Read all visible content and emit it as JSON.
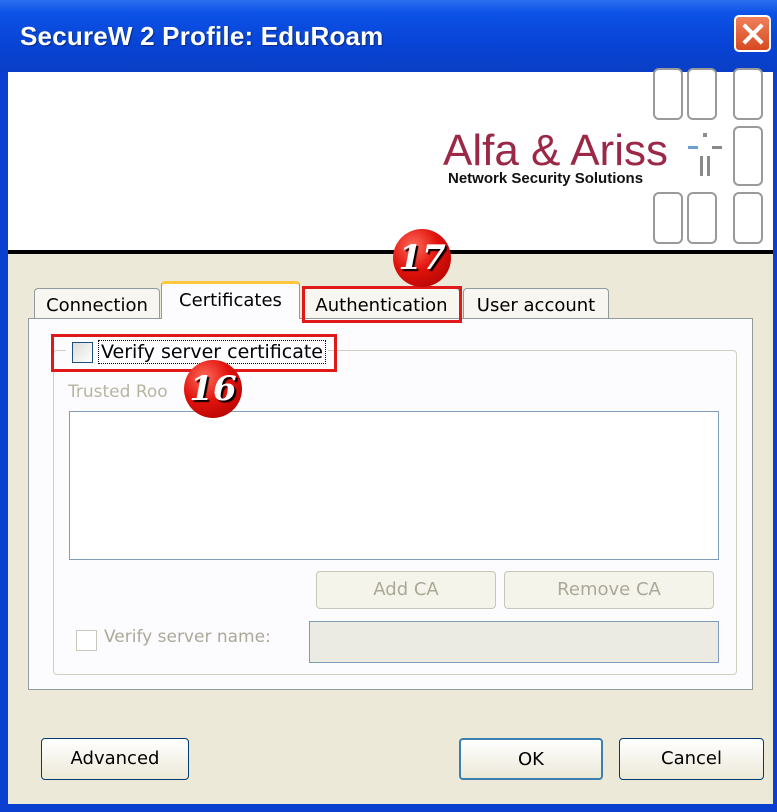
{
  "window": {
    "title": "SecureW 2 Profile: EduRoam"
  },
  "banner": {
    "company": "Alfa & Ariss",
    "tagline": "Network Security Solutions"
  },
  "tabs": [
    {
      "label": "Connection",
      "active": false
    },
    {
      "label": "Certificates",
      "active": true
    },
    {
      "label": "Authentication",
      "active": false
    },
    {
      "label": "User account",
      "active": false
    }
  ],
  "certificates": {
    "verify_server_certificate": {
      "label": "Verify server certificate",
      "checked": false
    },
    "trusted_root_label": "Trusted Roo",
    "add_ca": "Add CA",
    "remove_ca": "Remove CA",
    "verify_server_name": {
      "label": "Verify server name:",
      "checked": false
    },
    "server_name_value": ""
  },
  "buttons": {
    "advanced": "Advanced",
    "ok": "OK",
    "cancel": "Cancel"
  },
  "annotations": [
    {
      "number": "16",
      "target": "verify-server-certificate"
    },
    {
      "number": "17",
      "target": "tab-authentication"
    }
  ],
  "colors": {
    "titlebar": "#0c52e6",
    "company_text": "#9b2846",
    "annotation": "#e01818"
  }
}
